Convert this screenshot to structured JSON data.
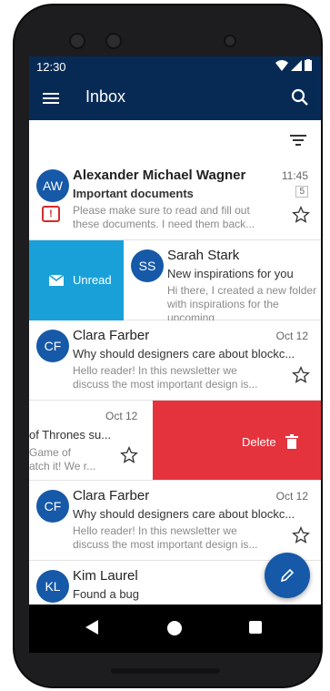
{
  "status_bar": {
    "time": "12:30",
    "icons": [
      "wifi-icon",
      "signal-icon",
      "battery-icon"
    ]
  },
  "app_bar": {
    "title": "Inbox",
    "icons": [
      "menu-icon",
      "search-icon"
    ]
  },
  "toolbar": {
    "icons": [
      "filter-icon"
    ]
  },
  "emails": [
    {
      "initials": "AW",
      "sender": "Alexander Michael Wagner",
      "subject": "Important documents",
      "snippet": "Please make sure to read and fill out these documents. I need them back...",
      "date": "11:45",
      "count": "5",
      "important": true,
      "unread": true
    },
    {
      "initials": "SS",
      "sender": "Sarah Stark",
      "subject": "New inspirations for you",
      "snippet": "Hi there, I created a new folder with inspirations for the upcoming",
      "date": "",
      "swipe_action": "Unread"
    },
    {
      "initials": "CF",
      "sender": "Clara Farber",
      "subject": "Why should designers care about blockc...",
      "snippet": "Hello reader! In this newsletter we discuss the most important design is...",
      "date": "Oct 12"
    },
    {
      "subject_partial": "of Thrones su...",
      "snippet_partial_1": "Game of",
      "snippet_partial_2": "atch it! We r...",
      "date": "Oct 12",
      "swipe_action": "Delete"
    },
    {
      "initials": "CF",
      "sender": "Clara Farber",
      "subject": "Why should designers care about blockc...",
      "snippet": "Hello reader! In this newsletter we discuss the most important design is...",
      "date": "Oct 12"
    },
    {
      "initials": "KL",
      "sender": "Kim Laurel",
      "subject": "Found a bug",
      "snippet": "",
      "date": ""
    }
  ],
  "fab": {
    "icon": "pencil-icon"
  },
  "colors": {
    "primary": "#072a55",
    "avatar": "#1659a8",
    "unread_action": "#1aa0d9",
    "delete_action": "#e5333e",
    "alert": "#d62b2b"
  }
}
